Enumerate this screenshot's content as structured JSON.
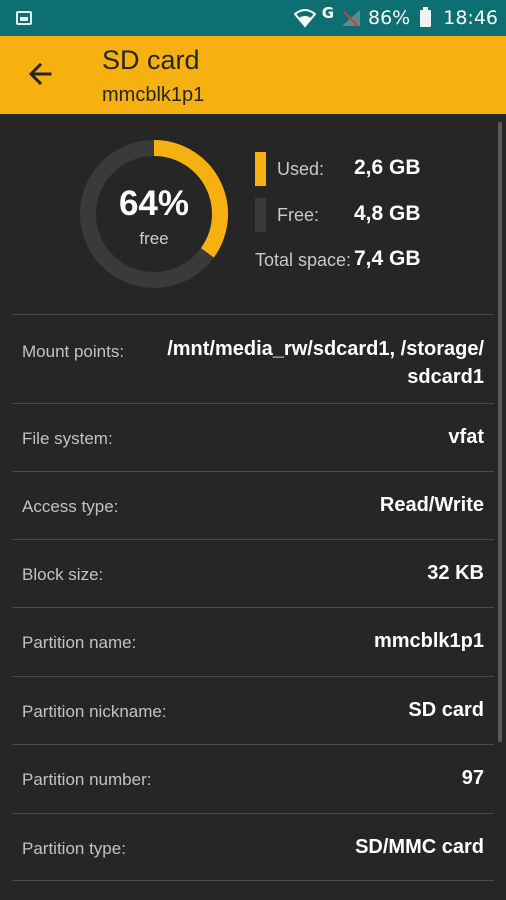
{
  "status_bar": {
    "gallery_icon": "image-icon",
    "network_type": "G",
    "battery_percent": "86%",
    "time": "18:46"
  },
  "app_bar": {
    "title": "SD card",
    "subtitle": "mmcblk1p1",
    "back_icon": "arrow-left-icon"
  },
  "storage": {
    "percent_free_text": "64%",
    "percent_free_label": "free",
    "used_fraction": 0.35,
    "used_label": "Used:",
    "used_value": "2,6 GB",
    "free_label": "Free:",
    "free_value": "4,8 GB",
    "total_label": "Total space:",
    "total_value": "7,4 GB",
    "used_color": "#f6b00f",
    "free_color": "#3a3a3a"
  },
  "details": [
    {
      "label": "Mount points:",
      "value": "/mnt/media_rw/sdcard1, /storage/sdcard1",
      "value_lines": [
        "/mnt/media_rw/sdcard1, /storage/",
        "sdcard1"
      ]
    },
    {
      "label": "File system:",
      "value": "vfat"
    },
    {
      "label": "Access type:",
      "value": "Read/Write"
    },
    {
      "label": "Block size:",
      "value": "32 KB"
    },
    {
      "label": "Partition name:",
      "value": "mmcblk1p1"
    },
    {
      "label": "Partition nickname:",
      "value": "SD card"
    },
    {
      "label": "Partition number:",
      "value": "97"
    },
    {
      "label": "Partition type:",
      "value": "SD/MMC card"
    }
  ]
}
